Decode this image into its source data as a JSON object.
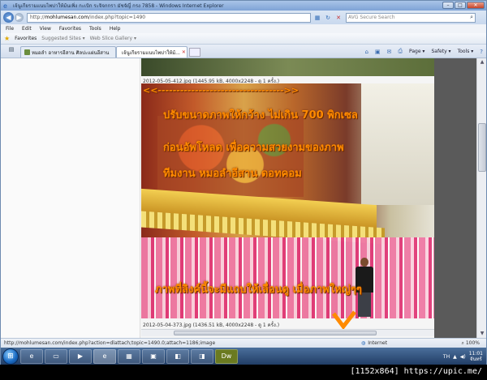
{
  "window": {
    "title": "เจ้นูเกียรามแนบไพบ่าให้ม้นเพิ่ง กะเบิก ระจิจกกรา มัชจัญี่ กรง 7858 - Windows Internet Explorer",
    "controls": {
      "minimize": "–",
      "maximize": "□",
      "close": "✕"
    }
  },
  "address_bar": {
    "url_domain": "mohlumesan.com",
    "url_prefix": "http://",
    "url_path": "/index.php?topic=1490",
    "search_placeholder": "AVG Secure Search"
  },
  "menu": [
    "File",
    "Edit",
    "View",
    "Favorites",
    "Tools",
    "Help"
  ],
  "favorites_bar": {
    "label": "Favorites",
    "items": [
      "Suggested Sites ▾",
      "Web Slice Gallery ▾"
    ]
  },
  "tabs": [
    {
      "label": "หมอลำ อาหารอีสาน ศิลปะแผ่นอีสาน"
    },
    {
      "label": "เจ้นูเกียรามแนบไพบ่าให้ม้..."
    }
  ],
  "command_bar": [
    "Page ▾",
    "Safety ▾",
    "Tools ▾"
  ],
  "content": {
    "caption_top": "2012-05-05-412.jpg (1445.95 kB, 4000x2248 - ดู 1 ครั้ง.)",
    "caption_bottom": "2012-05-04-373.jpg (1436.51 kB, 4000x2248 - ดู 1 ครั้ง.)",
    "overlay_arrow": "<<---------------------------------->>",
    "overlay_line1": "ปรับขนาดภาพให้กว้าง ไม่เกิน 700 พิกเซล",
    "overlay_line2": "ก่อนอัพโหลด เพื่อความสวยงามของภาพ",
    "overlay_line3": "ทีมงาน หมอลำอีสาน ดอทคอม",
    "overlay_line4": "ภาพที่ลิงค์นี้จะมีแถบให้เลื่อนดู เมื่อภาพใหญ่ๆๆ"
  },
  "status_bar": {
    "url": "http://mohlumesan.com/index.php?action=dlattach;topic=1490.0;attach=1186;image",
    "zone": "Internet",
    "zoom": "100%"
  },
  "taskbar": {
    "lang": "TH",
    "clock_time": "11:01",
    "clock_day": "จันทร์"
  },
  "watermark": "[1152x864] https://upic.me/"
}
